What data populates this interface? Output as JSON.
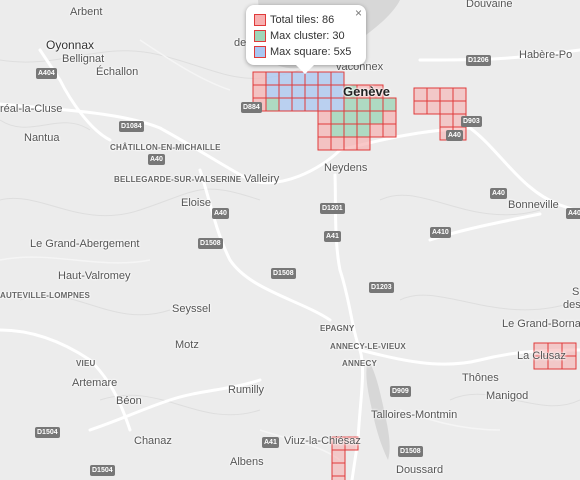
{
  "legend": {
    "total_tiles": "Total tiles: 86",
    "max_cluster": "Max cluster: 30",
    "max_square": "Max square: 5x5",
    "close": "×"
  },
  "colors": {
    "tile_stroke": "#e03a3a",
    "tile_fill": "#f7b0b0",
    "cluster_fill": "#9fd6b8",
    "square_fill": "#a9c7f2",
    "road": "#ffffff",
    "lake": "#d6d6d6"
  },
  "labels": {
    "arbent": "Arbent",
    "douvaine": "Douvaine",
    "oyonnax": "Oyonnax",
    "bellignat": "Bellignat",
    "echallon": "Échallon",
    "habere": "Habère-Po",
    "reale": "réal-la-Cluse",
    "nantua": "Nantua",
    "chatillon": "CHÂTILLON-EN-MICHAILLE",
    "bellegarde": "BELLEGARDE-SUR-VALSERINE",
    "valleiry": "Valleiry",
    "neydens": "Neydens",
    "geneve": "Genève",
    "de_partial": "de",
    "vaconnex": "vaconnex",
    "eloise": "Eloise",
    "bonneville": "Bonneville",
    "grand_abergement": "Le Grand-Abergement",
    "haut_valromey": "Haut-Valromey",
    "lompnes": "AUTEVILLE-LOMPNES",
    "seyssel": "Seyssel",
    "motz": "Motz",
    "epagny": "EPAGNY",
    "annecy_le_vieux": "ANNECY-LE-VIEUX",
    "annecy": "ANNECY",
    "grand_bornand": "Le Grand-Bornand",
    "la_clusaz": "La Clusaz",
    "vieu": "VIEU",
    "artemare": "Artemare",
    "beon": "Béon",
    "rumilly": "Rumilly",
    "thones": "Thônes",
    "manigod": "Manigod",
    "talloires": "Talloires-Montmin",
    "chanaz": "Chanaz",
    "viuz": "Viuz-la-Chiésaz",
    "albens": "Albens",
    "doussard": "Doussard",
    "s_partial": "S",
    "des_partial": "des"
  },
  "roads": {
    "a404": "A404",
    "d1206": "D1206",
    "d884": "D884",
    "d1084": "D1084",
    "a40_w": "A40",
    "d903": "D903",
    "a40_e": "A40",
    "a40_se": "A40",
    "a40_s": "A40",
    "d1201": "D1201",
    "a41_n": "A41",
    "a410": "A410",
    "d1508_a": "D1508",
    "d1508_b": "D1508",
    "d1203": "D1203",
    "d909": "D909",
    "d1504_a": "D1504",
    "d1504_b": "D1504",
    "a41_s": "A41",
    "d1508_c": "D1508",
    "a40_far": "A40"
  }
}
